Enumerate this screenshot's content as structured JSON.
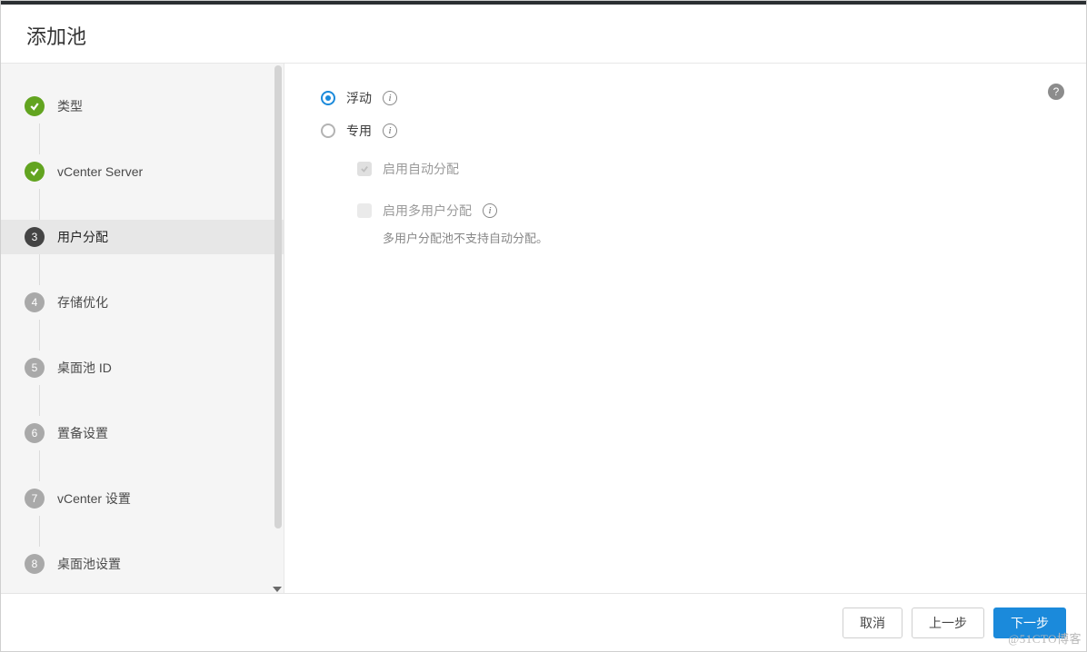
{
  "header": {
    "title": "添加池"
  },
  "sidebar": {
    "steps": [
      {
        "label": "类型",
        "state": "done"
      },
      {
        "label": "vCenter Server",
        "state": "done"
      },
      {
        "label": "用户分配",
        "state": "current",
        "num": "3"
      },
      {
        "label": "存储优化",
        "state": "todo",
        "num": "4"
      },
      {
        "label": "桌面池 ID",
        "state": "todo",
        "num": "5"
      },
      {
        "label": "置备设置",
        "state": "todo",
        "num": "6"
      },
      {
        "label": "vCenter 设置",
        "state": "todo",
        "num": "7"
      },
      {
        "label": "桌面池设置",
        "state": "todo",
        "num": "8"
      }
    ]
  },
  "main": {
    "option_floating": "浮动",
    "option_dedicated": "专用",
    "auto_assign": "启用自动分配",
    "multi_user": "启用多用户分配",
    "multi_user_note": "多用户分配池不支持自动分配。"
  },
  "footer": {
    "cancel": "取消",
    "prev": "上一步",
    "next": "下一步"
  },
  "watermark": "@51CTO博客"
}
